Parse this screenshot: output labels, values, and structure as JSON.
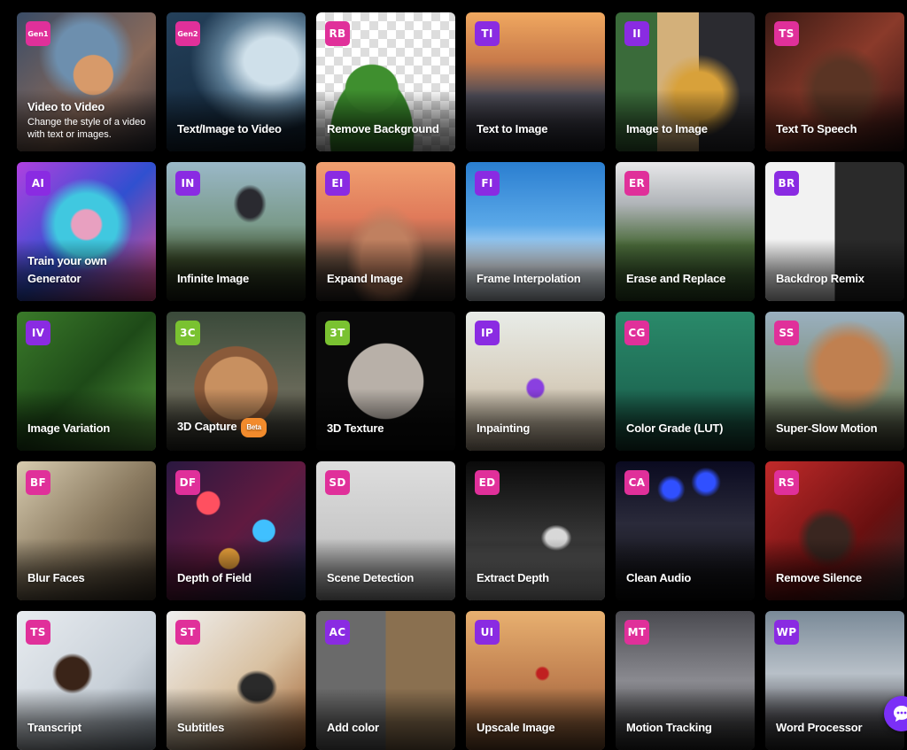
{
  "cards": [
    {
      "badge": "Gen1",
      "badge_color": "#e0309a",
      "icon": "video-to-video-art",
      "title": "Video to Video",
      "desc": "Change the style of a video with text or images."
    },
    {
      "badge": "Gen2",
      "badge_color": "#e0309a",
      "icon": "ocean-wave-art",
      "title": "Text/Image to Video"
    },
    {
      "badge": "RB",
      "badge_color": "#e0309a",
      "icon": "cutout-portrait-art",
      "title": "Remove Background"
    },
    {
      "badge": "TI",
      "badge_color": "#8a2be2",
      "icon": "city-skyline-art",
      "title": "Text to Image"
    },
    {
      "badge": "II",
      "badge_color": "#8a2be2",
      "icon": "jeep-art",
      "title": "Image to Image"
    },
    {
      "badge": "TS",
      "badge_color": "#e0309a",
      "icon": "woman-portrait-art",
      "title": "Text To Speech"
    },
    {
      "badge": "AI",
      "badge_color": "#8a2be2",
      "icon": "neon-portrait-art",
      "title": "Train your own Generator"
    },
    {
      "badge": "IN",
      "badge_color": "#8a2be2",
      "icon": "infinite-landscape-art",
      "title": "Infinite Image"
    },
    {
      "badge": "EI",
      "badge_color": "#8a2be2",
      "icon": "desert-rock-art",
      "title": "Expand Image"
    },
    {
      "badge": "FI",
      "badge_color": "#8a2be2",
      "icon": "airplane-art",
      "title": "Frame Interpolation"
    },
    {
      "badge": "ER",
      "badge_color": "#e0309a",
      "icon": "soccer-ball-art",
      "title": "Erase and Replace"
    },
    {
      "badge": "BR",
      "badge_color": "#8a2be2",
      "icon": "lounge-chair-art",
      "title": "Backdrop Remix"
    },
    {
      "badge": "IV",
      "badge_color": "#8a2be2",
      "icon": "frogs-art",
      "title": "Image Variation"
    },
    {
      "badge": "3C",
      "badge_color": "#7ac231",
      "icon": "planet-sphere-art",
      "title": "3D Capture",
      "tag": "Beta"
    },
    {
      "badge": "3T",
      "badge_color": "#7ac231",
      "icon": "stone-sphere-art",
      "title": "3D Texture"
    },
    {
      "badge": "IP",
      "badge_color": "#8a2be2",
      "icon": "grass-dune-art",
      "title": "Inpainting"
    },
    {
      "badge": "CG",
      "badge_color": "#e0309a",
      "icon": "skateboard-art",
      "title": "Color Grade (LUT)"
    },
    {
      "badge": "SS",
      "badge_color": "#e0309a",
      "icon": "horse-rider-art",
      "title": "Super-Slow Motion"
    },
    {
      "badge": "BF",
      "badge_color": "#e0309a",
      "icon": "cafe-people-art",
      "title": "Blur Faces"
    },
    {
      "badge": "DF",
      "badge_color": "#e0309a",
      "icon": "bokeh-lights-art",
      "title": "Depth of Field"
    },
    {
      "badge": "SD",
      "badge_color": "#e0309a",
      "icon": "running-people-art",
      "title": "Scene Detection"
    },
    {
      "badge": "ED",
      "badge_color": "#e0309a",
      "icon": "depth-map-art",
      "title": "Extract Depth"
    },
    {
      "badge": "CA",
      "badge_color": "#e0309a",
      "icon": "concert-crowd-art",
      "title": "Clean Audio"
    },
    {
      "badge": "RS",
      "badge_color": "#e0309a",
      "icon": "boombox-art",
      "title": "Remove Silence"
    },
    {
      "badge": "TS",
      "badge_color": "#e0309a",
      "icon": "podcast-mic-art",
      "title": "Transcript"
    },
    {
      "badge": "ST",
      "badge_color": "#e0309a",
      "icon": "phone-hands-art",
      "title": "Subtitles"
    },
    {
      "badge": "AC",
      "badge_color": "#8a2be2",
      "icon": "colorized-city-art",
      "title": "Add color"
    },
    {
      "badge": "UI",
      "badge_color": "#8a2be2",
      "icon": "ladybug-art",
      "title": "Upscale Image"
    },
    {
      "badge": "MT",
      "badge_color": "#e0309a",
      "icon": "skater-tracking-art",
      "title": "Motion Tracking"
    },
    {
      "badge": "WP",
      "badge_color": "#8a2be2",
      "icon": "skatepark-art",
      "title": "Word Processor"
    }
  ],
  "chat_icon": "chat-bubble-icon"
}
